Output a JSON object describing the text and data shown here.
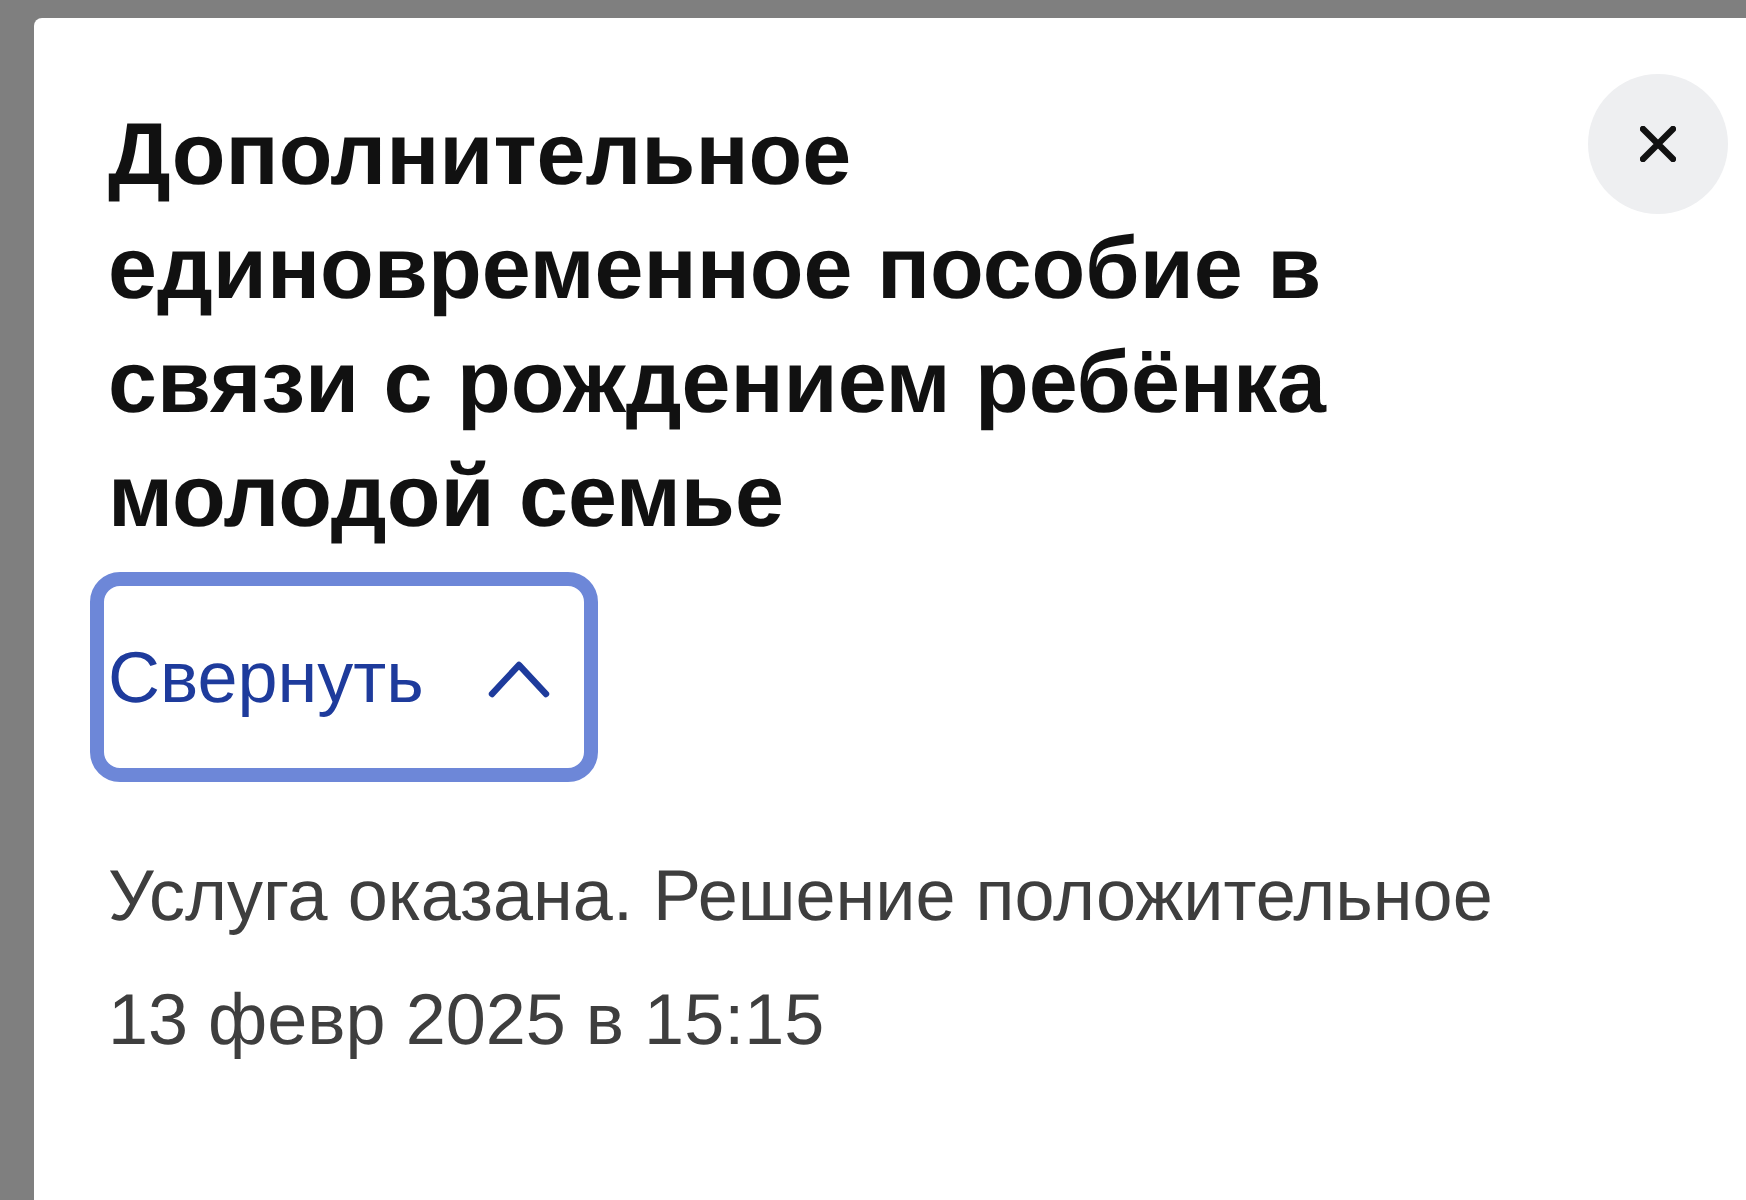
{
  "dialog": {
    "title": "Дополнительное единовременное пособие в связи с рождением ребёнка молодой семье",
    "toggle": {
      "label": "Свернуть",
      "expanded": true,
      "focused": true
    },
    "status": "Услуга оказана. Решение положительное",
    "date": "13 февр 2025 в 15:15"
  }
}
